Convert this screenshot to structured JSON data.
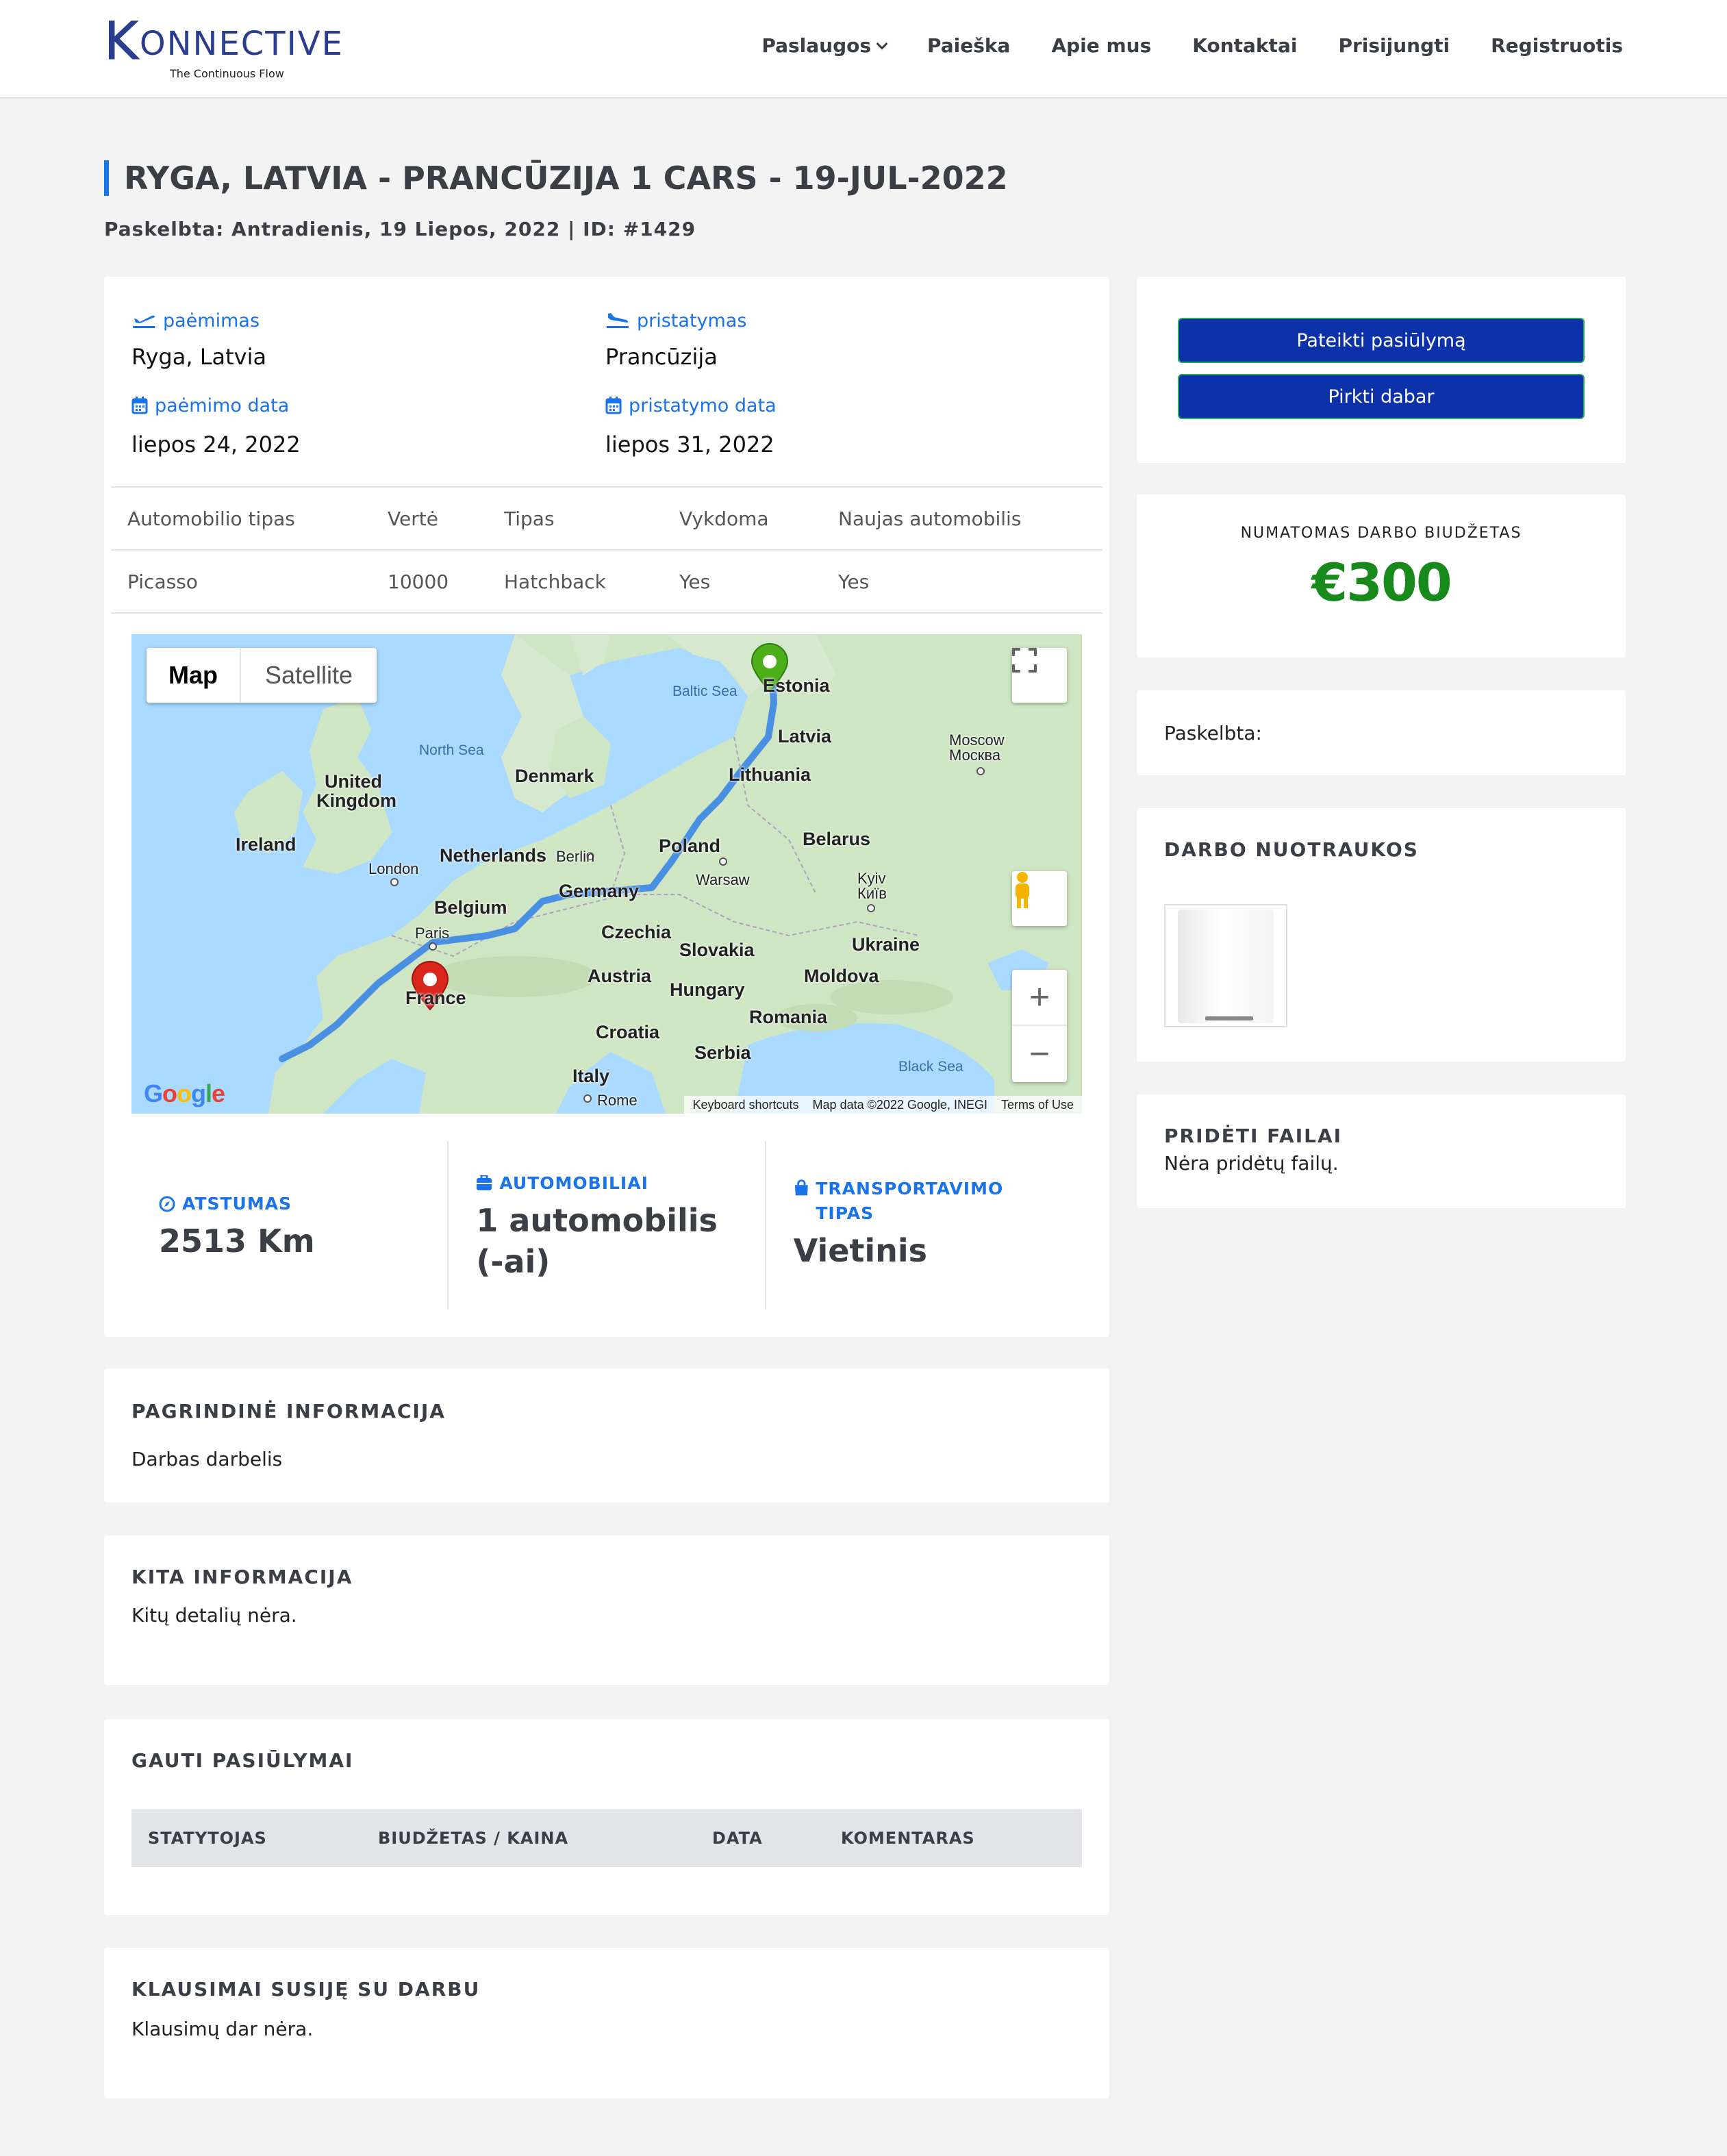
{
  "header": {
    "logo_letter": "K",
    "logo_rest": "ONNECTIVE",
    "logo_tagline": "The Continuous Flow",
    "nav": [
      "Paslaugos",
      "Paieška",
      "Apie mus",
      "Kontaktai",
      "Prisijungti",
      "Registruotis"
    ]
  },
  "page": {
    "title": "RYGA, LATVIA - PRANCŪZIJA 1 CARS - 19-JUL-2022",
    "subtitle": "Paskelbta: Antradienis, 19 Liepos, 2022 | ID: #1429"
  },
  "route": {
    "pickup_label": "paėmimas",
    "pickup_value": "Ryga, Latvia",
    "pickup_date_label": "paėmimo data",
    "pickup_date_value": "liepos 24, 2022",
    "delivery_label": "pristatymas",
    "delivery_value": "Prancūzija",
    "delivery_date_label": "pristatymo data",
    "delivery_date_value": "liepos 31, 2022"
  },
  "specs": {
    "headers": [
      "Automobilio tipas",
      "Vertė",
      "Tipas",
      "Vykdoma",
      "Naujas automobilis"
    ],
    "row": [
      "Picasso",
      "10000",
      "Hatchback",
      "Yes",
      "Yes"
    ]
  },
  "map": {
    "tab_map": "Map",
    "tab_satellite": "Satellite",
    "attribution": [
      "Keyboard shortcuts",
      "Map data ©2022 Google, INEGI",
      "Terms of Use"
    ],
    "labels": {
      "baltic": "Baltic Sea",
      "estonia": "Estonia",
      "latvia": "Latvia",
      "moscow": "Moscow",
      "moscow_ru": "Москва",
      "north_sea": "North Sea",
      "denmark": "Denmark",
      "uk1": "United",
      "uk2": "Kingdom",
      "lithuania": "Lithuania",
      "ireland": "Ireland",
      "netherlands": "Netherlands",
      "berlin": "Berlin",
      "poland": "Poland",
      "belarus": "Belarus",
      "london": "London",
      "warsaw": "Warsaw",
      "germany": "Germany",
      "kyiv": "Kyiv",
      "kyiv_ua": "Київ",
      "belgium": "Belgium",
      "paris": "Paris",
      "czechia": "Czechia",
      "slovakia": "Slovakia",
      "ukraine": "Ukraine",
      "austria": "Austria",
      "moldova": "Moldova",
      "france": "France",
      "hungary": "Hungary",
      "romania": "Romania",
      "croatia": "Croatia",
      "serbia": "Serbia",
      "black_sea": "Black Sea",
      "italy": "Italy",
      "rome": "Rome"
    },
    "google": "Google"
  },
  "stats": {
    "distance_label": "ATSTUMAS",
    "distance_value": "2513 Km",
    "cars_label": "AUTOMOBILIAI",
    "cars_value": "1 automobilis (-ai)",
    "transport_label": "TRANSPORTAVIMO TIPAS",
    "transport_value": "Vietinis"
  },
  "main_info": {
    "title": "PAGRINDINĖ INFORMACIJA",
    "text": "Darbas darbelis"
  },
  "other_info": {
    "title": "KITA INFORMACIJA",
    "text": "Kitų detalių nėra."
  },
  "bids": {
    "title": "GAUTI PASIŪLYMAI",
    "columns": [
      "STATYTOJAS",
      "BIUDŽETAS / KAINA",
      "DATA",
      "KOMENTARAS"
    ]
  },
  "questions": {
    "title": "KLAUSIMAI SUSIJĘ SU DARBU",
    "text": "Klausimų dar nėra."
  },
  "sidebar": {
    "submit_offer": "Pateikti pasiūlymą",
    "buy_now": "Pirkti dabar",
    "budget_label": "NUMATOMAS DARBO BIUDŽETAS",
    "budget_value": "€300",
    "posted_label": "Paskelbta:",
    "photos_title": "DARBO NUOTRAUKOS",
    "files_title": "PRIDĖTI FAILAI",
    "files_text": "Nėra pridėtų failų."
  },
  "colors": {
    "accent": "#1a73e8",
    "button": "#0d31a8",
    "budget": "#188a1c",
    "route": "#4a90e2",
    "origin_pin": "#4caf1a",
    "dest_pin": "#d9261c"
  }
}
